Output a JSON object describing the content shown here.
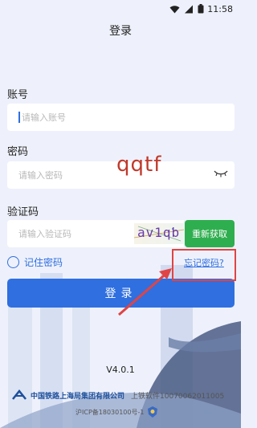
{
  "status_bar": {
    "time": "11:58",
    "icons": [
      "wifi-icon",
      "signal-icon",
      "battery-icon"
    ]
  },
  "header": {
    "title": "登录"
  },
  "account": {
    "label": "账号",
    "placeholder": "请输入账号"
  },
  "password": {
    "label": "密码",
    "placeholder": "请输入密码"
  },
  "annotation_text": "qqtf",
  "captcha": {
    "label": "验证码",
    "placeholder": "请输入验证码",
    "image_text": "av1qb",
    "refresh_label": "重新获取"
  },
  "remember": {
    "label": "记住密码"
  },
  "forgot": {
    "label": "忘记密码?"
  },
  "login": {
    "label": "登录"
  },
  "footer": {
    "version": "V4.0.1",
    "company": "中国铁路上海局集团有限公司",
    "software": "上铁软件10070062011005",
    "icp": "沪ICP备18030100号-1"
  },
  "colors": {
    "primary": "#2f6fe0",
    "refresh": "#2fae4f",
    "annotation": "#e04444"
  }
}
